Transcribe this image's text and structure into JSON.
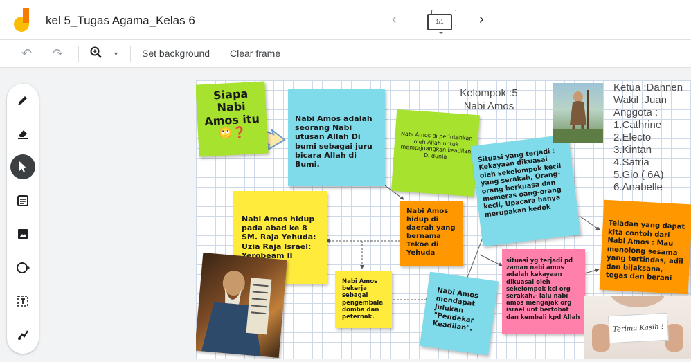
{
  "header": {
    "title": "kel 5_Tugas Agama_Kelas 6",
    "frame_indicator": "1/1"
  },
  "toolbar": {
    "set_background": "Set background",
    "clear_frame": "Clear frame"
  },
  "notes": {
    "siapa": "Siapa Nabi Amos itu 🙄❓",
    "nabi_amos_adalah": "Nabi Amos adalah seorang Nabi utusan Allah Di bumi sebagai juru bicara Allah di Bumi.",
    "diperintahkan": "Nabi Amos di perintahkan oleh Allah untuk memprjuangkan keadilan Di dunia",
    "situasi1": "Situasi yang terjadi : Kekayaan dikuasai oleh sekelompok kecil yang serakah, Orang-orang berkuasa dan memeras oang-orang kecil, Upacara hanya merupakan kedok",
    "hidup_abad": "Nabi Amos hidup pada abad ke 8 SM. Raja Yehuda: Uzia Raja Israel: Yerobeam II",
    "hidup_daerah": "Nabi Amos hidup di daerah yang bernama Tekoe di Yehuda",
    "teladan": "Teladan yang dapat kita contoh dari Nabi Amos : Mau menolong sesama yang tertindas, adil dan bijaksana, tegas dan berani",
    "bekerja": "Nabi Amos bekerja sebagai pengembala domba dan peternak.",
    "julukan": "Nabi Amos mendapat julukan \"Pendekar Keadilan\".",
    "situasi2": "situasi yg terjadi pd zaman nabi amos adalah kekayaan dikuasai oleh sekelompok kcl org serakah.- lalu nabi amos mengajak org israel unt bertobat dan kembali kpd Allah"
  },
  "text_boxes": {
    "kelompok": "Kelompok :5\nNabi Amos",
    "anggota": "Ketua :Dannen\nWakil :Juan\nAnggota :\n1.Cathrine\n2.Electo\n3.Kintan\n4.Satria\n5.Gio ( 6A)\n6.Anabelle"
  },
  "images": {
    "thanks_sign": "Terima Kasih !"
  },
  "colors": {
    "green": "#a6e22e",
    "cyan": "#7fdbe9",
    "yellow": "#ffeb3b",
    "orange": "#ff9800",
    "pink": "#ff80ab"
  }
}
